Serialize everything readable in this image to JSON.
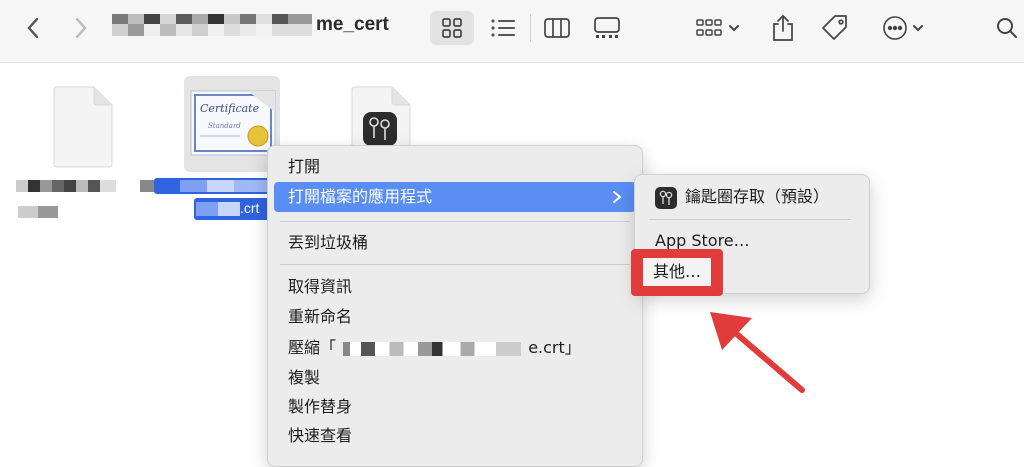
{
  "toolbar": {
    "title_visible": "me_cert",
    "icons": [
      "chevron-left-icon",
      "chevron-right-icon",
      "grid-view-icon",
      "list-view-icon",
      "column-view-icon",
      "gallery-view-icon",
      "group-icon",
      "share-icon",
      "tag-icon",
      "more-icon",
      "search-icon"
    ]
  },
  "files": [
    {
      "name_line1": "",
      "name_line2": "ca-bundle",
      "icon": "blank-document-icon"
    },
    {
      "name_visible": ".crt",
      "icon": "certificate-icon",
      "selected": true
    },
    {
      "icon": "keychain-document-icon"
    }
  ],
  "context_menu": {
    "items": {
      "open": "打開",
      "open_with": "打開檔案的應用程式",
      "trash": "丟到垃圾桶",
      "get_info": "取得資訊",
      "rename": "重新命名",
      "compress_prefix": "壓縮「",
      "compress_suffix": "e.crt」",
      "duplicate": "複製",
      "make_alias": "製作替身",
      "quick_look": "快速查看"
    }
  },
  "submenu": {
    "keychain": "鑰匙圈存取（預設）",
    "app_store": "App Store…",
    "other": "其他…"
  },
  "annotation": {
    "color": "#e23b3b"
  }
}
